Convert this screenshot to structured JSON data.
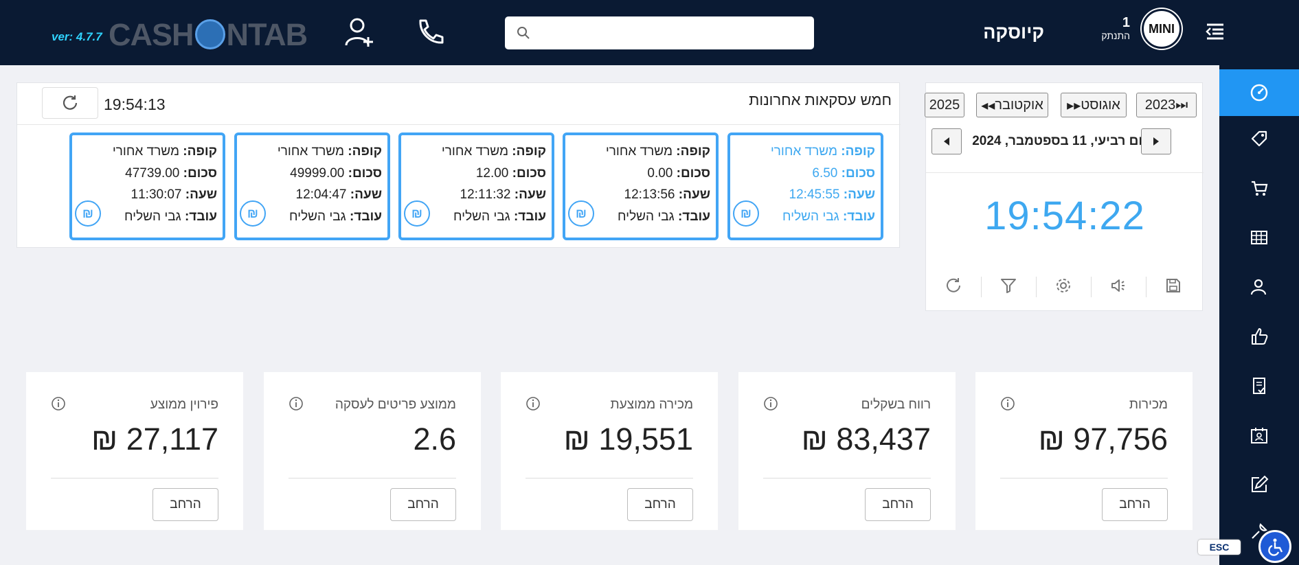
{
  "header": {
    "version": "ver: 4.7.7",
    "logo_text_left": "CASH",
    "logo_text_right": "NTAB",
    "title": "קיוסקה",
    "user_count": "1",
    "logout_label": "התנתק",
    "avatar_text": "MINI",
    "search_placeholder": "",
    "icons": [
      "add-user-icon",
      "phone-icon",
      "search-icon",
      "menu-toggle-icon"
    ]
  },
  "sidebar": {
    "items": [
      "dashboard-icon",
      "tag-icon",
      "cart-icon",
      "table-icon",
      "customers-icon",
      "thumbs-up-icon",
      "document-check-icon",
      "calendar-badge-icon",
      "edit-icon",
      "tools-icon"
    ]
  },
  "clock_panel": {
    "year_prev_label": "2023",
    "month_prev_label": "אוגוסט",
    "month_next_label": "אוקטובר",
    "year_next_label": "2025",
    "date": "יום רביעי, 11 בספטמבר, 2024",
    "time": "19:54:22",
    "tools": [
      "save-icon",
      "speaker-icon",
      "settings-icon",
      "filter-icon",
      "refresh-icon"
    ]
  },
  "transactions": {
    "title": "חמש עסקאות אחרונות",
    "last_refresh": "19:54:13",
    "labels": {
      "register": "קופה:",
      "amount": "סכום:",
      "time": "שעה:",
      "employee": "עובד:"
    },
    "coin_symbol": "₪",
    "items": [
      {
        "register": "משרד אחורי",
        "amount": "6.50",
        "time": "12:45:55",
        "employee": "גבי השליח"
      },
      {
        "register": "משרד אחורי",
        "amount": "0.00",
        "time": "12:13:56",
        "employee": "גבי השליח"
      },
      {
        "register": "משרד אחורי",
        "amount": "12.00",
        "time": "12:11:32",
        "employee": "גבי השליח"
      },
      {
        "register": "משרד אחורי",
        "amount": "49999.00",
        "time": "12:04:47",
        "employee": "גבי השליח"
      },
      {
        "register": "משרד אחורי",
        "amount": "47739.00",
        "time": "11:30:07",
        "employee": "גבי השליח"
      }
    ]
  },
  "stats": {
    "more_label": "הרחב",
    "cards": [
      {
        "label": "מכירות",
        "value": "₪ 97,756"
      },
      {
        "label": "רווח בשקלים",
        "value": "₪ 83,437"
      },
      {
        "label": "מכירה ממוצעת",
        "value": "₪ 19,551"
      },
      {
        "label": "ממוצע פריטים לעסקה",
        "value": "2.6"
      },
      {
        "label": "פירוין ממוצע",
        "value": "₪ 27,117"
      }
    ]
  },
  "footer": {
    "esc_label": "ESC"
  },
  "colors": {
    "topbar": "#0a1a33",
    "accent": "#2196f3",
    "time_blue": "#3ea8f0",
    "card_border": "#42a5f5"
  }
}
